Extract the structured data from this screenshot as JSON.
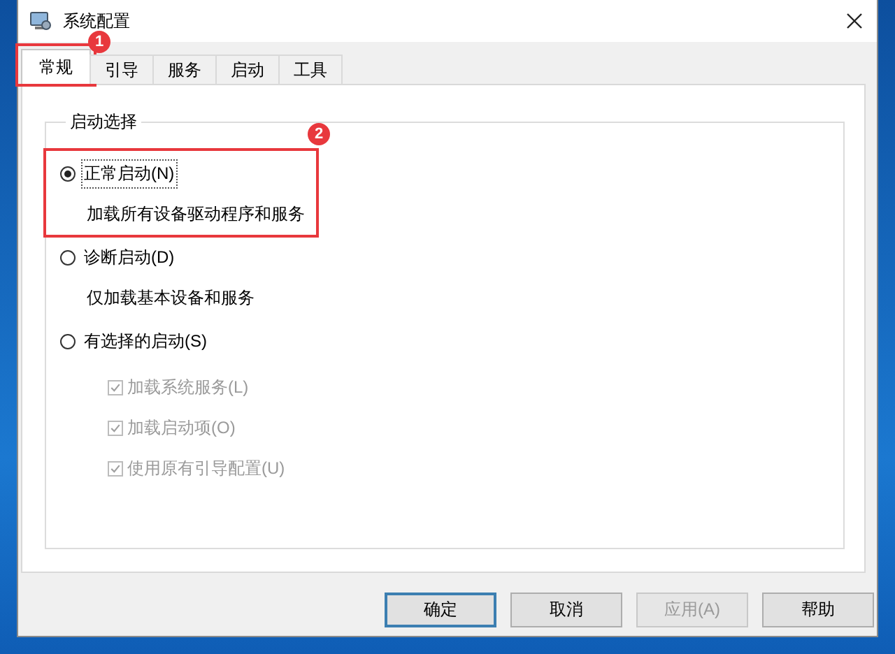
{
  "window": {
    "title": "系统配置"
  },
  "tabs": [
    {
      "label": "常规",
      "selected": true,
      "annotation": "1"
    },
    {
      "label": "引导",
      "selected": false
    },
    {
      "label": "服务",
      "selected": false
    },
    {
      "label": "启动",
      "selected": false
    },
    {
      "label": "工具",
      "selected": false
    }
  ],
  "group": {
    "title": "启动选择",
    "options": [
      {
        "label": "正常启动(N)",
        "description": "加载所有设备驱动程序和服务",
        "selected": true,
        "annotation": "2"
      },
      {
        "label": "诊断启动(D)",
        "description": "仅加载基本设备和服务",
        "selected": false
      },
      {
        "label": "有选择的启动(S)",
        "selected": false,
        "children": [
          {
            "label": "加载系统服务(L)",
            "checked": true,
            "disabled": true
          },
          {
            "label": "加载启动项(O)",
            "checked": true,
            "disabled": true
          },
          {
            "label": "使用原有引导配置(U)",
            "checked": true,
            "disabled": true
          }
        ]
      }
    ]
  },
  "buttons": [
    {
      "label": "确定",
      "default": true,
      "disabled": false
    },
    {
      "label": "取消",
      "default": false,
      "disabled": false
    },
    {
      "label": "应用(A)",
      "default": false,
      "disabled": true
    },
    {
      "label": "帮助",
      "default": false,
      "disabled": false
    }
  ]
}
